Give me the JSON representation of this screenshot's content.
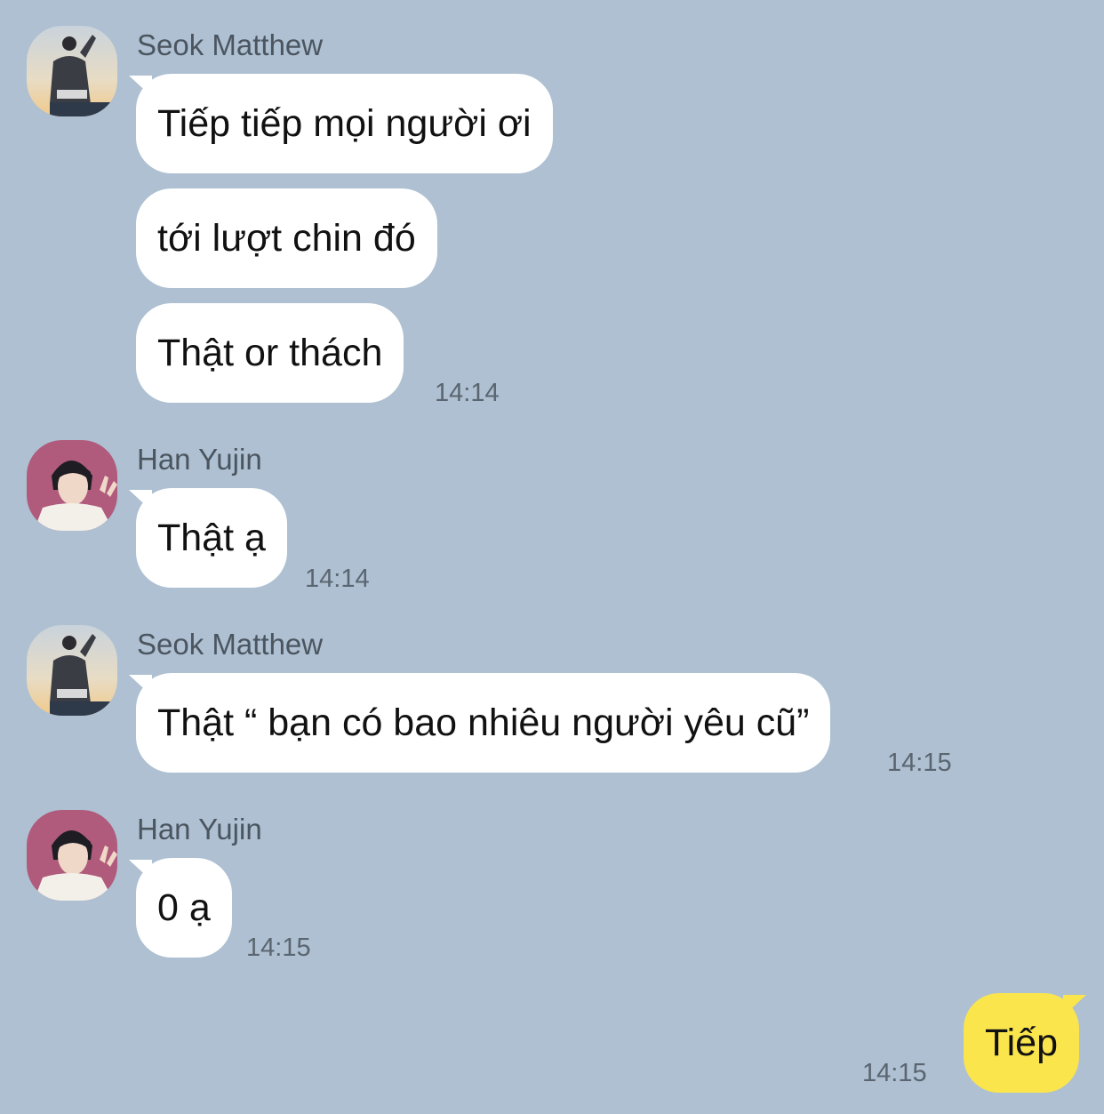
{
  "messages": [
    {
      "sender": "Seok Matthew",
      "bubbles": [
        "Tiếp tiếp mọi người ơi",
        "tới lượt chin đó",
        "Thật or thách"
      ],
      "time": "14:14"
    },
    {
      "sender": "Han Yujin",
      "bubbles": [
        "Thật ạ"
      ],
      "time": "14:14"
    },
    {
      "sender": "Seok Matthew",
      "bubbles": [
        "Thật “ bạn có bao nhiêu người yêu cũ”"
      ],
      "time": "14:15"
    },
    {
      "sender": "Han Yujin",
      "bubbles": [
        "0 ạ"
      ],
      "time": "14:15"
    }
  ],
  "my_message": {
    "text": "Tiếp",
    "time": "14:15"
  },
  "colors": {
    "background": "#aec0d1",
    "incoming_bubble": "#ffffff",
    "outgoing_bubble": "#fae54d"
  },
  "icons": {
    "avatar_seok": "avatar-photo-icon",
    "avatar_han": "avatar-photo-icon"
  }
}
